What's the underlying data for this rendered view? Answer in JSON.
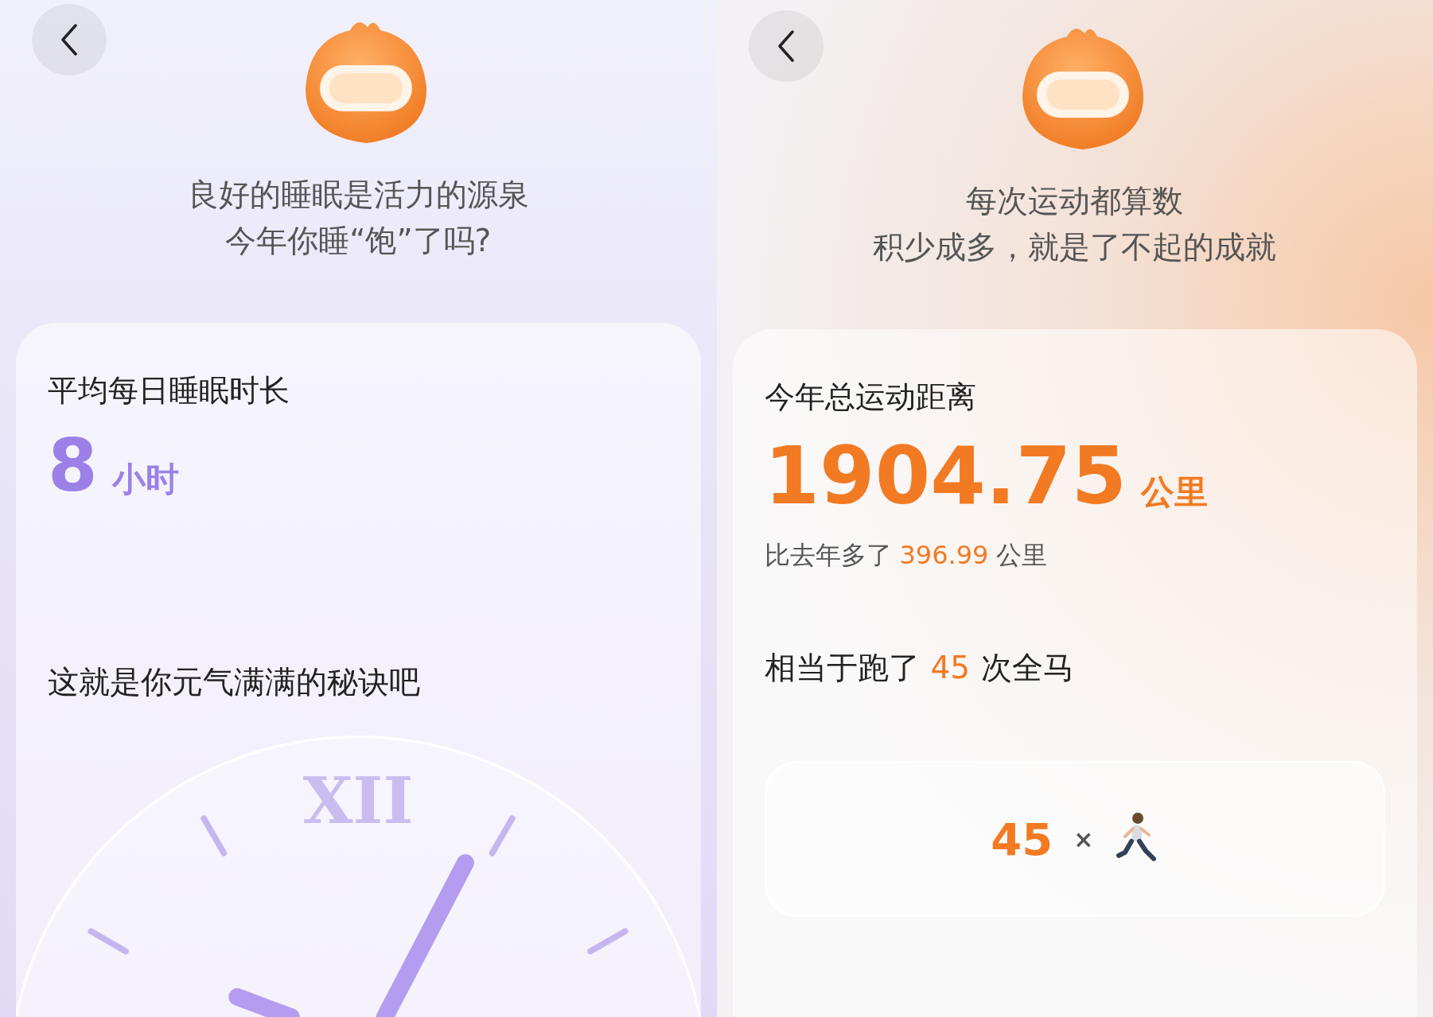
{
  "panels": [
    {
      "kind": "sleep",
      "headline": [
        "良好的睡眠是活力的源泉",
        "今年你睡“饱”了吗?"
      ],
      "card": {
        "label": "平均每日睡眠时长",
        "value": "8",
        "unit": "小时",
        "caption": "这就是你元气满满的秘诀吧",
        "clock_numeral": "XII"
      }
    },
    {
      "kind": "sport",
      "headline": [
        "每次运动都算数",
        "积少成多，就是了不起的成就"
      ],
      "card": {
        "label": "今年总运动距离",
        "value": "1904.75",
        "unit": "公里",
        "compare": {
          "prefix": "比去年多了",
          "amount": "396.99",
          "suffix": "公里"
        },
        "equivalent": {
          "prefix": "相当于跑了",
          "count": "45",
          "suffix": "次全马"
        },
        "badge": {
          "count": "45",
          "times": "×"
        }
      }
    }
  ]
}
